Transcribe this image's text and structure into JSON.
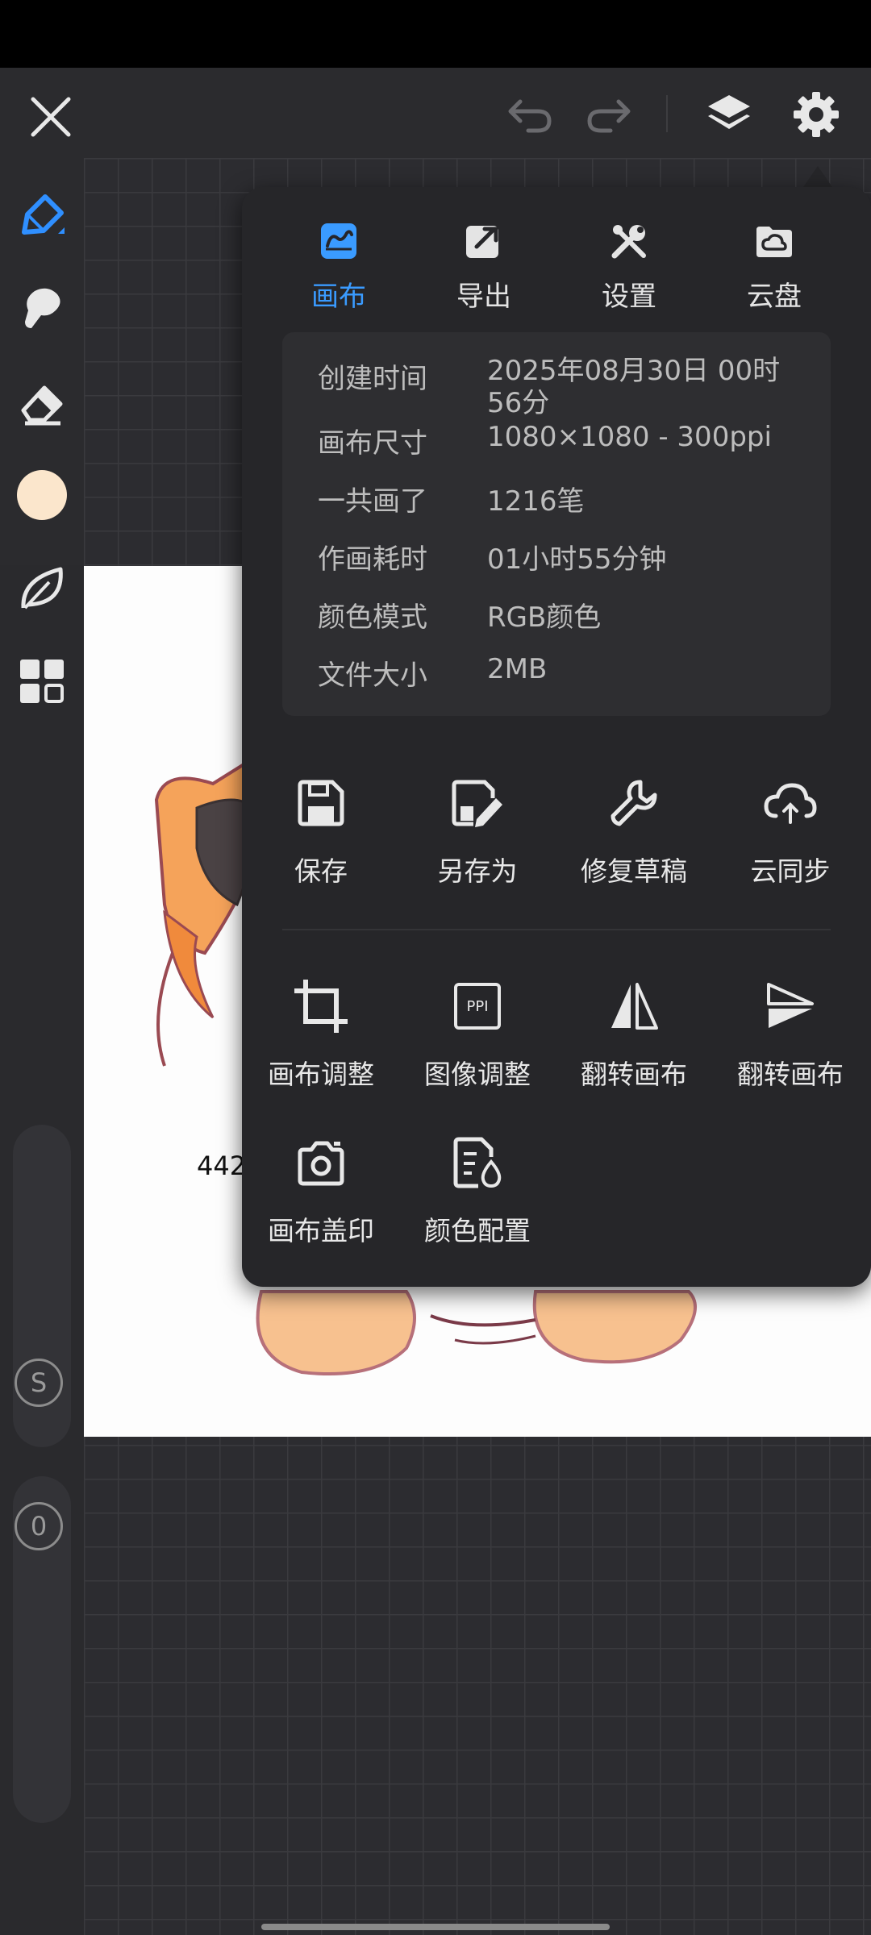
{
  "tabs": [
    {
      "label": "画布",
      "icon": "canvas-icon",
      "active": true
    },
    {
      "label": "导出",
      "icon": "export-icon",
      "active": false
    },
    {
      "label": "设置",
      "icon": "tools-icon",
      "active": false
    },
    {
      "label": "云盘",
      "icon": "cloud-drive-icon",
      "active": false
    }
  ],
  "info": {
    "created_label": "创建时间",
    "created_value": "2025年08月30日 00时56分",
    "size_label": "画布尺寸",
    "size_value": "1080×1080 - 300ppi",
    "strokes_label": "一共画了",
    "strokes_value": "1216笔",
    "duration_label": "作画耗时",
    "duration_value": "01小时55分钟",
    "color_label": "颜色模式",
    "color_value": "RGB颜色",
    "file_label": "文件大小",
    "file_value": "2MB"
  },
  "actions": {
    "save": "保存",
    "save_as": "另存为",
    "repair": "修复草稿",
    "cloud_sync": "云同步",
    "canvas_adjust": "画布调整",
    "image_adjust": "图像调整",
    "flip_h": "翻转画布",
    "flip_v": "翻转画布",
    "canvas_stamp": "画布盖印",
    "color_profile": "颜色配置",
    "ppi_badge": "PPI"
  },
  "sliders": {
    "size_badge": "S",
    "opacity_badge": "0"
  },
  "artwork": {
    "sketch_text": "442"
  },
  "colors": {
    "accent": "#3a9bff",
    "current_color": "#fbe6cc",
    "panel_bg": "#262629"
  }
}
